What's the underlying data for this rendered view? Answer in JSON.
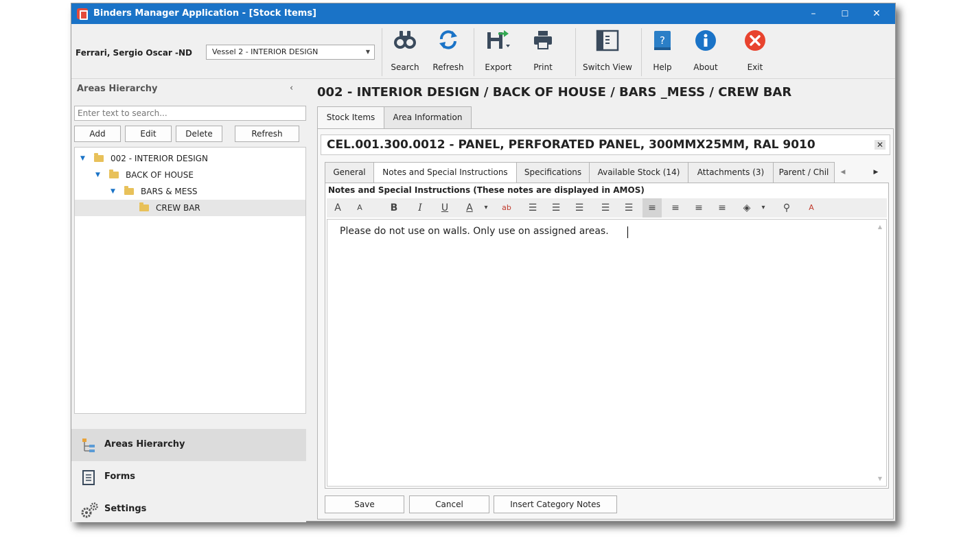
{
  "window": {
    "title": "Binders Manager Application - [Stock Items]",
    "controls": {
      "minimize": "–",
      "maximize": "☐",
      "close": "✕"
    }
  },
  "toolbar": {
    "user": "Ferrari, Sergio Oscar -ND",
    "vessel": "Vessel 2 - INTERIOR DESIGN",
    "buttons": [
      {
        "label": "Search",
        "icon": "binoculars-icon"
      },
      {
        "label": "Refresh",
        "icon": "refresh-icon"
      },
      {
        "label": "Export",
        "icon": "export-icon"
      },
      {
        "label": "Print",
        "icon": "printer-icon"
      },
      {
        "label": "Switch View",
        "icon": "switch-view-icon"
      },
      {
        "label": "Help",
        "icon": "help-book-icon"
      },
      {
        "label": "About",
        "icon": "info-icon"
      },
      {
        "label": "Exit",
        "icon": "exit-icon"
      }
    ]
  },
  "left_panel": {
    "header": "Areas Hierarchy",
    "collapse": "‹",
    "search_placeholder": "Enter text to search...",
    "buttons": {
      "add": "Add",
      "edit": "Edit",
      "delete": "Delete",
      "refresh": "Refresh"
    },
    "tree": [
      {
        "label": "002 - INTERIOR DESIGN",
        "level": 0,
        "expanded": true
      },
      {
        "label": "BACK OF HOUSE",
        "level": 1,
        "expanded": true
      },
      {
        "label": "BARS & MESS",
        "level": 2,
        "expanded": true
      },
      {
        "label": "CREW BAR",
        "level": 3,
        "selected": true
      }
    ],
    "nav": [
      {
        "label": "Areas Hierarchy",
        "icon": "hierarchy-icon",
        "active": true
      },
      {
        "label": "Forms",
        "icon": "form-icon"
      },
      {
        "label": "Settings",
        "icon": "gears-icon"
      }
    ]
  },
  "main": {
    "breadcrumb": "002 - INTERIOR DESIGN / BACK OF HOUSE / BARS _MESS / CREW BAR",
    "outer_tabs": [
      "Stock Items",
      "Area Information"
    ],
    "item_title": "CEL.001.300.0012 - PANEL, PERFORATED PANEL, 300MMX25MM, RAL 9010",
    "item_close": "✕",
    "inner_tabs": [
      "General",
      "Notes and Special Instructions",
      "Specifications",
      "Available Stock (14)",
      "Attachments (3)",
      "Parent / Chil"
    ],
    "tab_nav": {
      "prev": "◀",
      "next": "▶"
    },
    "notes_caption": "Notes and Special Instructions (These notes are displayed in AMOS)",
    "format_buttons": {
      "grow": "A",
      "shrink": "A",
      "bold": "B",
      "italic": "I",
      "underline": "U",
      "font_color": "A",
      "dropdown": "▾",
      "highlight": "ab",
      "bullets": "☰",
      "numbering": "☰",
      "multilevel": "☰",
      "decrease_indent": "☰",
      "increase_indent": "☰",
      "align_left": "≡",
      "align_center": "≡",
      "align_right": "≡",
      "justify": "≡",
      "fill": "◈",
      "find": "⚲",
      "replace": "A"
    },
    "note_text": "Please do not use on walls. Only use on assigned areas.",
    "scroll": {
      "up": "▲",
      "down": "▼"
    },
    "buttons": {
      "save": "Save",
      "cancel": "Cancel",
      "insert": "Insert Category Notes"
    }
  },
  "colors": {
    "titlebar": "#1a73c7",
    "accent": "#1a73c7",
    "exit": "#e8432e",
    "folder": "#e8c15a"
  }
}
